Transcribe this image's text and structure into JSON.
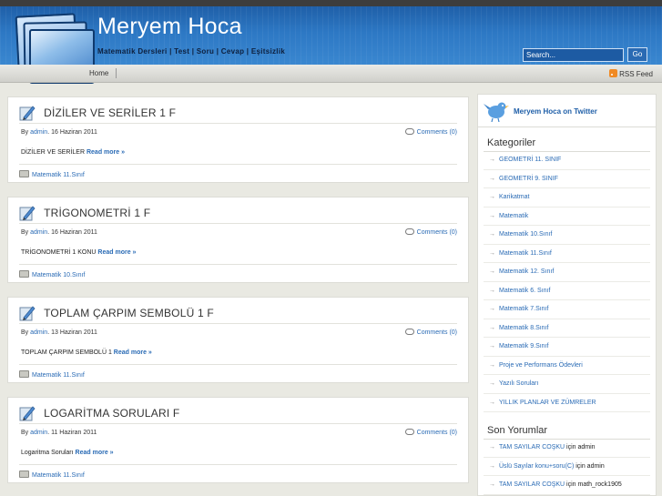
{
  "site": {
    "title": "Meryem Hoca",
    "description": "Matematik Dersleri | Test | Soru | Cevap | Eşitsizlik"
  },
  "search": {
    "placeholder": "Search...",
    "button_label": "Go"
  },
  "nav": {
    "home_label": "Home",
    "rss_label": "RSS Feed"
  },
  "posts": [
    {
      "title": "DİZİLER VE SERİLER 1 F",
      "by": "By",
      "author": "admin",
      "date": "16 Haziran 2011",
      "comments": "Comments (0)",
      "excerpt": "DİZİLER VE SERİLER",
      "read_more": "Read more »",
      "category": "Matematik 11.Sınıf"
    },
    {
      "title": "TRİGONOMETRİ 1 F",
      "by": "By",
      "author": "admin",
      "date": "16 Haziran 2011",
      "comments": "Comments (0)",
      "excerpt": "TRİGONOMETRİ 1 KONU",
      "read_more": "Read more »",
      "category": "Matematik 10.Sınıf"
    },
    {
      "title": "TOPLAM ÇARPIM SEMBOLÜ 1 F",
      "by": "By",
      "author": "admin",
      "date": "13 Haziran 2011",
      "comments": "Comments (0)",
      "excerpt": "TOPLAM ÇARPIM SEMBOLÜ 1",
      "read_more": "Read more »",
      "category": "Matematik 11.Sınıf"
    },
    {
      "title": "LOGARİTMA SORULARI F",
      "by": "By",
      "author": "admin",
      "date": "11 Haziran 2011",
      "comments": "Comments (0)",
      "excerpt": "Logaritma Soruları",
      "read_more": "Read more »",
      "category": "Matematik 11.Sınıf"
    }
  ],
  "sidebar": {
    "twitter_label": "Meryem Hoca on Twitter",
    "categories_title": "Kategoriler",
    "categories": [
      "GEOMETRİ 11. SINIF",
      "GEOMETRİ 9. SINIF",
      "Karikatmat",
      "Matematik",
      "Matematik 10.Sınıf",
      "Matematik 11.Sınıf",
      "Matematik 12. Sınıf",
      "Matematik 6. Sınıf",
      "Matematik 7.Sınıf",
      "Matematik 8.Sınıf",
      "Matematik 9.Sınıf",
      "Proje ve Performans Ödevleri",
      "Yazılı Soruları",
      "YILLIK PLANLAR VE ZÜMRELER"
    ],
    "recent_title": "Son Yorumlar",
    "recent_comments": [
      {
        "author": "TAM SAYILAR COŞKU",
        "text": "için admin"
      },
      {
        "author": "Üslü Sayılar konu+soru(C)",
        "text": "için admin"
      },
      {
        "author": "TAM SAYILAR COŞKU",
        "text": "için math_rock1905"
      }
    ]
  },
  "colors": {
    "header_blue": "#2d78c4",
    "link": "#2a6bb5",
    "page_bg": "#e9e9e2"
  }
}
